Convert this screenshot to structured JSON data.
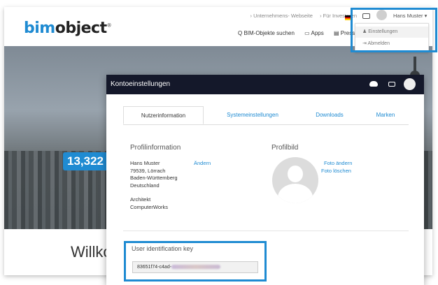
{
  "site": {
    "logo_part1": "bim",
    "logo_part2": "object",
    "logo_mark": "®",
    "links": [
      "› Unternehmens- Webseite",
      "› Für Investoren"
    ],
    "nav": [
      "Q BIM-Objekte suchen",
      "▭ Apps",
      "▤ Presse"
    ],
    "user_name": "Hans Muster",
    "user_menu": [
      "Einstellungen",
      "Abmelden"
    ],
    "counter": "13,322",
    "welcome": "Willko"
  },
  "modal": {
    "title": "Kontoeinstellungen",
    "tabs": [
      "Nutzerinformation",
      "Systemeinstellungen",
      "Downloads",
      "Marken"
    ],
    "profile_info_title": "Profilinformation",
    "address_lines": [
      "Hans Muster",
      "79539, Lörrach",
      "Baden-Württemberg",
      "Deutschland"
    ],
    "profession_lines": [
      "Architekt",
      "ComputerWorks"
    ],
    "edit_link": "Ändern",
    "profile_image_title": "Profilbild",
    "photo_change": "Foto ändern",
    "photo_delete": "Foto löschen",
    "key_label": "User identification key",
    "key_value": "83651f74-c4ad-"
  },
  "colors": {
    "accent": "#1f8bd2",
    "header_bg": "#14182a"
  }
}
